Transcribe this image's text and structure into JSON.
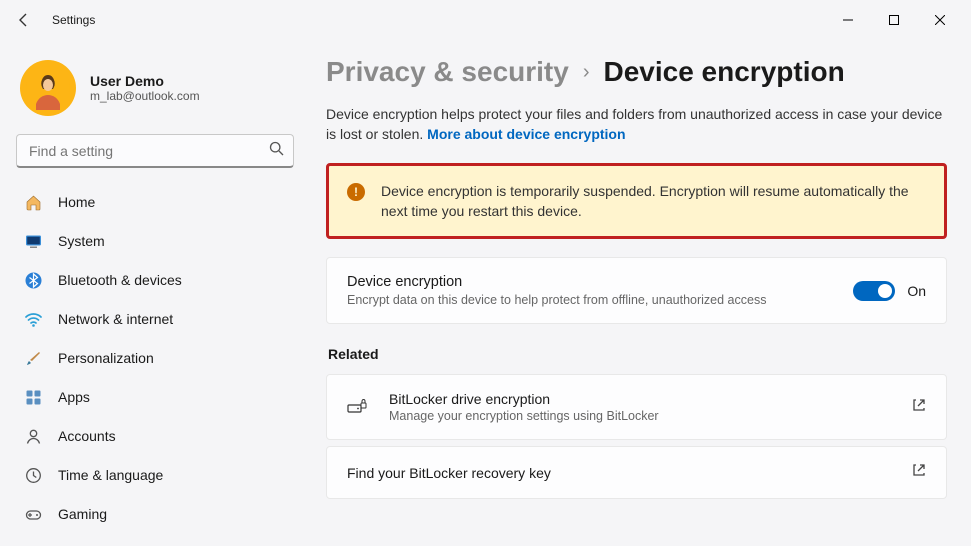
{
  "window": {
    "title": "Settings"
  },
  "user": {
    "name": "User Demo",
    "email": "m_lab@outlook.com"
  },
  "search": {
    "placeholder": "Find a setting"
  },
  "sidebar": {
    "items": [
      {
        "label": "Home"
      },
      {
        "label": "System"
      },
      {
        "label": "Bluetooth & devices"
      },
      {
        "label": "Network & internet"
      },
      {
        "label": "Personalization"
      },
      {
        "label": "Apps"
      },
      {
        "label": "Accounts"
      },
      {
        "label": "Time & language"
      },
      {
        "label": "Gaming"
      }
    ]
  },
  "breadcrumb": {
    "parent": "Privacy & security",
    "current": "Device encryption"
  },
  "description": {
    "text": "Device encryption helps protect your files and folders from unauthorized access in case your device is lost or stolen. ",
    "link": "More about device encryption"
  },
  "warning": {
    "text": "Device encryption is temporarily suspended. Encryption will resume automatically the next time you restart this device."
  },
  "encryption_card": {
    "title": "Device encryption",
    "subtitle": "Encrypt data on this device to help protect from offline, unauthorized access",
    "state_label": "On"
  },
  "related": {
    "heading": "Related",
    "items": [
      {
        "title": "BitLocker drive encryption",
        "subtitle": "Manage your encryption settings using BitLocker"
      },
      {
        "title": "Find your BitLocker recovery key",
        "subtitle": ""
      }
    ]
  }
}
